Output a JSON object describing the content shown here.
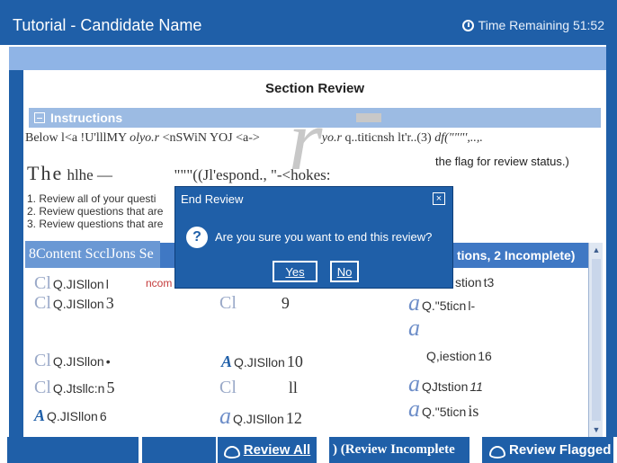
{
  "header": {
    "app_title": "Tutorial - Candidate Name",
    "timer": "Time Remaining 51:52"
  },
  "section": {
    "title": "Section Review",
    "instructions_label": "Instructions",
    "ocr_line1_a": "Below l<a !U'lllMY",
    "ocr_line1_b": "olyo.r",
    "ocr_line1_c": "<nSWiN YOJ <a->",
    "ocr_line1_d": "yo.r",
    "ocr_line1_e": "q..titicnsh lt'r..(3)",
    "ocr_line1_f": "df(\"\"\"',..,.",
    "ocr_line2_a": "The",
    "ocr_line2_b": "hlhe —",
    "ocr_line2_c": "\"\"\"((Jl'espond., \"-<hokes:",
    "big_r": "r",
    "steps": [
      "1. Review all of your questi",
      "2. Review questions that are",
      "3. Review questions that are"
    ],
    "step3_tail": "the flag for review status.)",
    "tab_left": "8Content ScclJons Se",
    "tab_right": "tions, 2 Incomplete)"
  },
  "questions": {
    "incomplete_label": "ncom",
    "items": [
      {
        "prefix": "Cl",
        "label": "Q.JISllon",
        "num": "l"
      },
      {
        "prefix": "Cl",
        "label": "Q.JISllon",
        "num": "3"
      },
      {
        "prefix": "Cl",
        "label": "",
        "num": "9"
      },
      {
        "prefix": "",
        "label": "stion",
        "num": "t3"
      },
      {
        "prefix": "a",
        "label": "Q.\"5ticn",
        "num": "l-"
      },
      {
        "prefix": "a",
        "label": "",
        "num": ""
      },
      {
        "prefix": "Cl",
        "label": "Q.JISllon",
        "num": "•"
      },
      {
        "prefix": "A",
        "label": "Q.JISllon",
        "num": "10"
      },
      {
        "prefix": "",
        "label": "Q,iestion",
        "num": "16"
      },
      {
        "prefix": "Cl",
        "label": "Q.Jtsllc:n",
        "num": "5"
      },
      {
        "prefix": "Cl",
        "label": "",
        "num": "ll"
      },
      {
        "prefix": "a",
        "label": "QJtstion",
        "num": "11"
      },
      {
        "prefix": "A",
        "label": "Q.JISllon",
        "num": "6"
      },
      {
        "prefix": "a",
        "label": "Q.JISllon",
        "num": "12"
      },
      {
        "prefix": "a",
        "label": "Q.\"5ticn",
        "num": "is"
      }
    ]
  },
  "footer": {
    "review_all": "Review All",
    "review_incomplete": ") (Review Incomplete",
    "review_flagged": "Review Flagged"
  },
  "dialog": {
    "title": "End Review",
    "message": "Are you sure you want to end this review?",
    "yes": "Yes",
    "no": "No",
    "close": "×"
  }
}
